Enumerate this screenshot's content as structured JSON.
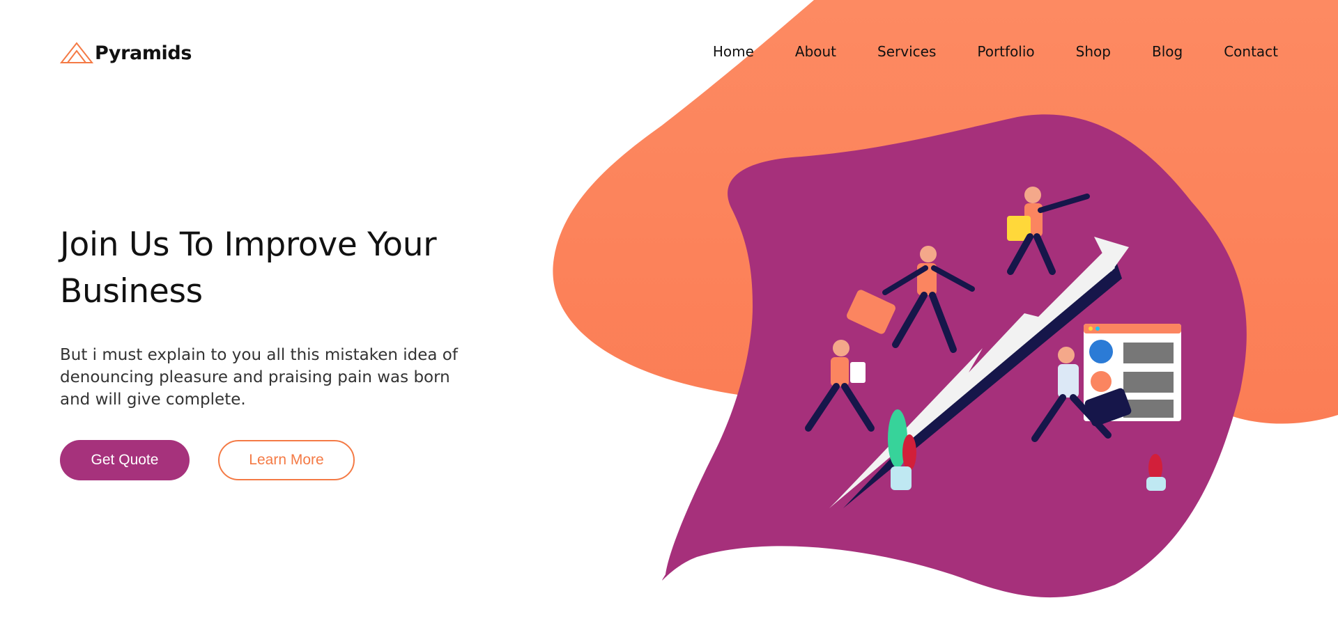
{
  "brand": {
    "name": "Pyramids",
    "icon": "pyramid-logo-icon",
    "accent": "#f47a45"
  },
  "nav": {
    "items": [
      {
        "label": "Home"
      },
      {
        "label": "About"
      },
      {
        "label": "Services"
      },
      {
        "label": "Portfolio"
      },
      {
        "label": "Shop"
      },
      {
        "label": "Blog"
      },
      {
        "label": "Contact"
      }
    ]
  },
  "hero": {
    "title": "Join Us To Improve Your Business",
    "description": "But i must explain to you all this mistaken idea of denouncing pleasure and praising pain was born and will give complete.",
    "primary_button": "Get Quote",
    "secondary_button": "Learn More"
  },
  "colors": {
    "primary": "#a6327c",
    "orange": "#fb8560",
    "outline": "#f47a45",
    "dark_navy": "#16164a"
  },
  "illustration": {
    "subject": "team-climbing-growth-arrow-illustration"
  }
}
